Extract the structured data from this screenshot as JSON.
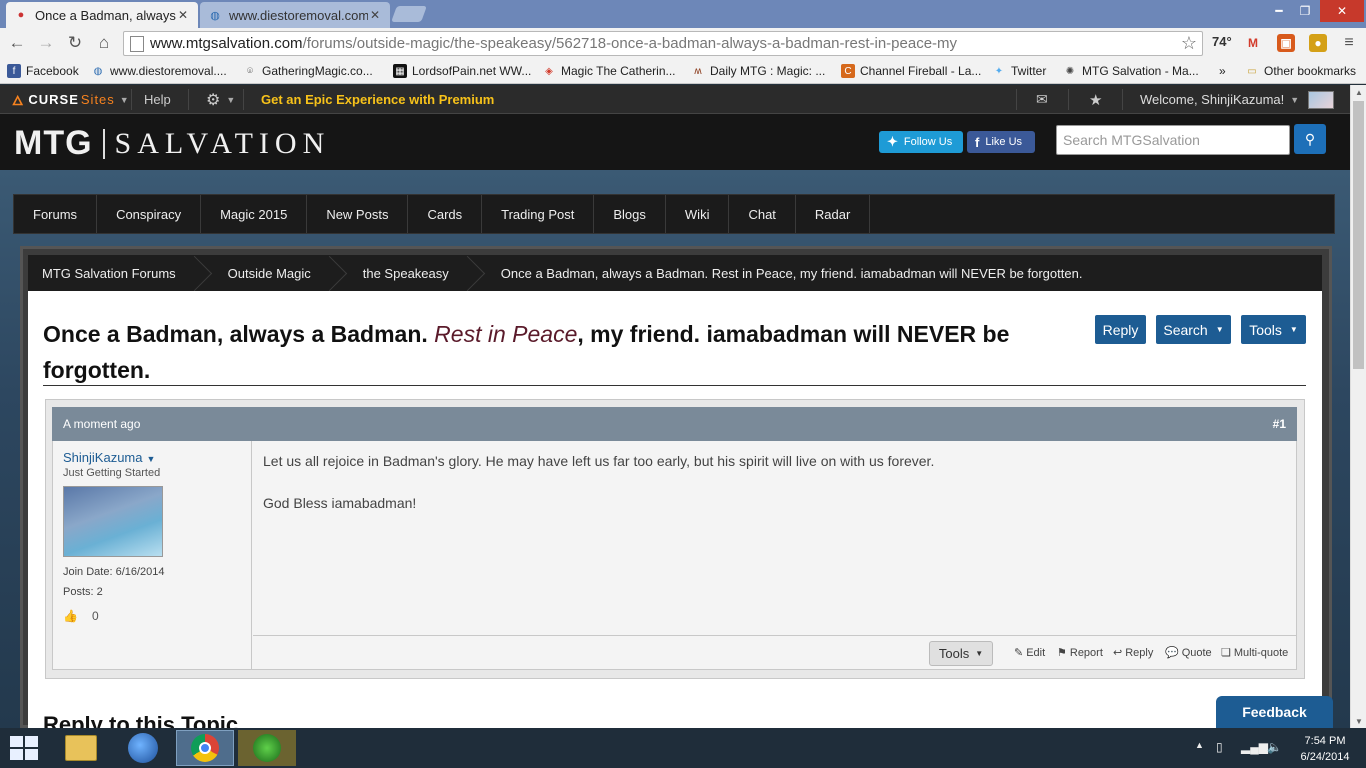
{
  "browser": {
    "tabs": [
      {
        "title": "Once a Badman, always a"
      },
      {
        "title": "www.diestoremoval.com"
      }
    ],
    "url": {
      "host": "www.mtgsalvation.com",
      "path": "/forums/outside-magic/the-speakeasy/562718-once-a-badman-always-a-badman-rest-in-peace-my"
    },
    "weather": "74°",
    "bookmarks": [
      {
        "label": "Facebook",
        "icon": "facebook-icon",
        "color": "#3b5998"
      },
      {
        "label": "www.diestoremoval....",
        "icon": "globe-icon",
        "color": "#2a6ab0"
      },
      {
        "label": "GatheringMagic.co...",
        "icon": "gm-icon",
        "color": "#555555"
      },
      {
        "label": "LordsofPain.net WW...",
        "icon": "lop-icon",
        "color": "#111111"
      },
      {
        "label": "Magic The Catherin...",
        "icon": "mtg-icon",
        "color": "#d23b2b"
      },
      {
        "label": "Daily MTG : Magic: ...",
        "icon": "dailymtg-icon",
        "color": "#8a3a1a"
      },
      {
        "label": "Channel Fireball - La...",
        "icon": "cfb-icon",
        "color": "#d6691c"
      },
      {
        "label": "Twitter",
        "icon": "twitter-icon",
        "color": "#55acee"
      },
      {
        "label": "MTG Salvation - Ma...",
        "icon": "mtgs-icon",
        "color": "#444444"
      }
    ],
    "bookmarks_more": "»",
    "other_bookmarks": "Other bookmarks"
  },
  "site": {
    "curse_logo": "CURSE",
    "curse_sites": "Sites",
    "help": "Help",
    "premium": "Get an Epic Experience with Premium",
    "welcome": "Welcome, ShinjiKazuma!",
    "logo_left": "MTG",
    "logo_right": "SALVATION",
    "follow_us": "Follow Us",
    "like_us": "Like Us",
    "search_placeholder": "Search MTGSalvation",
    "nav": [
      "Forums",
      "Conspiracy",
      "Magic 2015",
      "New Posts",
      "Cards",
      "Trading Post",
      "Blogs",
      "Wiki",
      "Chat",
      "Radar"
    ],
    "breadcrumb": [
      "MTG Salvation Forums",
      "Outside Magic",
      "the Speakeasy",
      "Once a Badman, always a Badman. Rest in Peace, my friend. iamabadman will NEVER be forgotten."
    ]
  },
  "thread": {
    "title_part1": "Once a Badman, always a Badman. ",
    "title_em": "Rest in Peace",
    "title_part2": ", my friend. iamabadman will NEVER be forgotten.",
    "reply_btn": "Reply",
    "search_btn": "Search",
    "tools_btn": "Tools"
  },
  "post": {
    "time": "A moment ago",
    "number": "#1",
    "username": "ShinjiKazuma",
    "rank": "Just Getting Started",
    "join_date": "Join Date: 6/16/2014",
    "posts": "Posts: 2",
    "likes": "0",
    "body_line1": "Let us all rejoice in Badman's glory. He may have left us far too early, but his spirit will live on with us forever.",
    "body_line2": "God Bless iamabadman!",
    "tools": "Tools",
    "actions": {
      "edit": "Edit",
      "report": "Report",
      "reply": "Reply",
      "quote": "Quote",
      "multiquote": "Multi-quote"
    }
  },
  "reply_heading": "Reply to this Topic",
  "feedback": "Feedback",
  "taskbar": {
    "time": "7:54 PM",
    "date": "6/24/2014"
  },
  "colors": {
    "accent": "#1d5c93",
    "premium": "#f7c21a",
    "curse_orange": "#f6821f"
  }
}
